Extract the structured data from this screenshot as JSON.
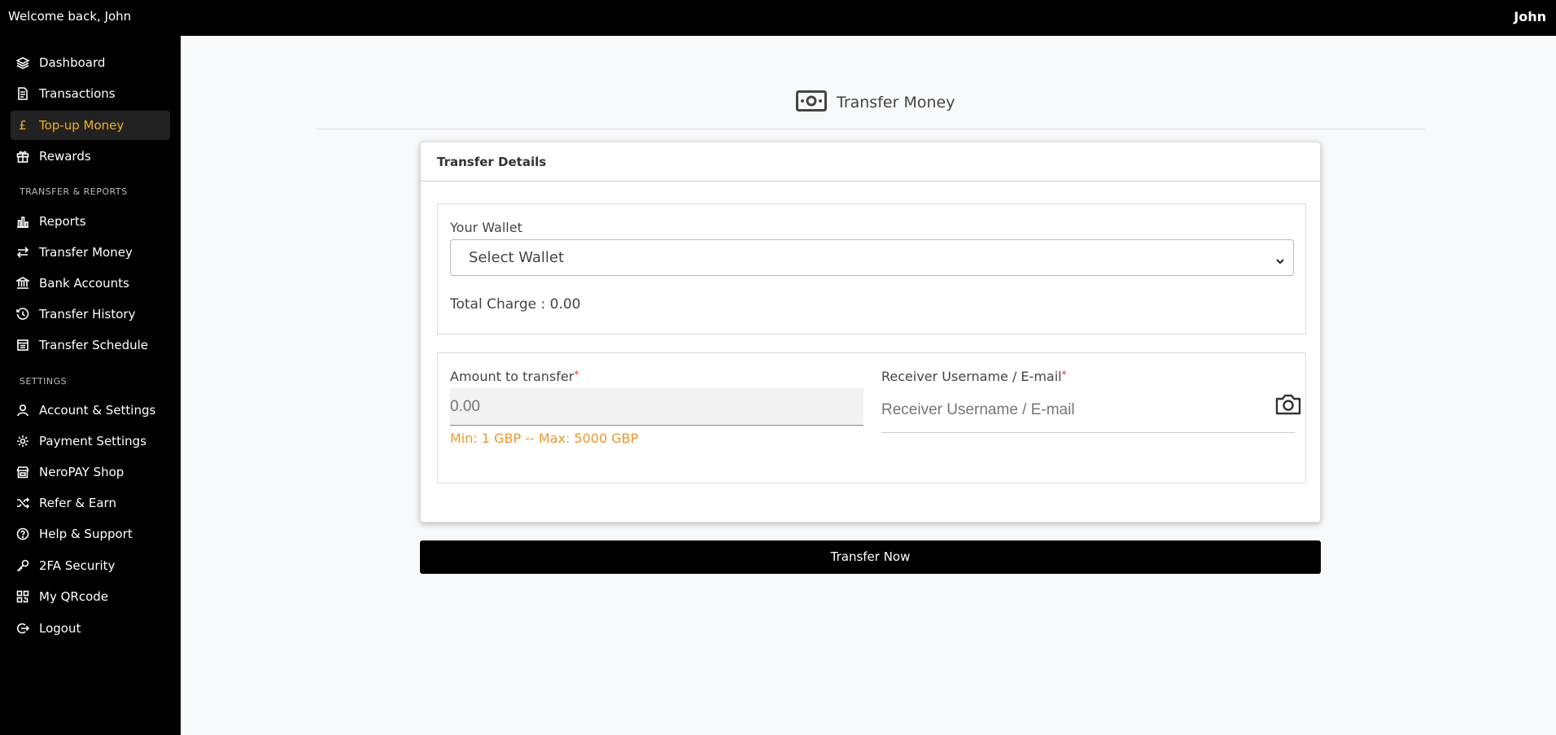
{
  "topbar": {
    "welcome": "Welcome back, John",
    "username": "John"
  },
  "sidebar": {
    "items": [
      {
        "label": "Dashboard",
        "icon": "layers-icon"
      },
      {
        "label": "Transactions",
        "icon": "document-icon"
      },
      {
        "label": "Top-up Money",
        "icon": "pound-icon",
        "active": true
      },
      {
        "label": "Rewards",
        "icon": "gift-icon"
      },
      {
        "label": "Reports",
        "icon": "bar-chart-icon"
      },
      {
        "label": "Transfer Money",
        "icon": "transfer-arrows-icon"
      },
      {
        "label": "Bank Accounts",
        "icon": "bank-icon"
      },
      {
        "label": "Transfer History",
        "icon": "history-icon"
      },
      {
        "label": "Transfer Schedule",
        "icon": "schedule-icon"
      },
      {
        "label": "Account & Settings",
        "icon": "user-icon"
      },
      {
        "label": "Payment Settings",
        "icon": "gear-icon"
      },
      {
        "label": "NeroPAY Shop",
        "icon": "shop-icon"
      },
      {
        "label": "Refer & Earn",
        "icon": "shuffle-icon"
      },
      {
        "label": "Help & Support",
        "icon": "help-icon"
      },
      {
        "label": "2FA Security",
        "icon": "key-icon"
      },
      {
        "label": "My QRcode",
        "icon": "qrcode-icon"
      },
      {
        "label": "Logout",
        "icon": "logout-icon"
      }
    ],
    "sections": {
      "transfer_reports": "TRANSFER & REPORTS",
      "settings": "SETTINGS"
    }
  },
  "page": {
    "title": "Transfer Money",
    "icon": "money-bill-icon"
  },
  "card": {
    "title": "Transfer Details",
    "wallet_label": "Your Wallet",
    "wallet_selected": "Select Wallet",
    "total_charge": "Total Charge : 0.00",
    "amount_label": "Amount to transfer",
    "amount_placeholder": "0.00",
    "amount_hint": "Min: 1 GBP -- Max: 5000 GBP",
    "receiver_label": "Receiver Username / E-mail",
    "receiver_placeholder": "Receiver Username / E-mail",
    "required_mark": "*"
  },
  "actions": {
    "transfer_now": "Transfer Now"
  },
  "colors": {
    "accent": "#f2b01e",
    "hint": "#f0962b",
    "required": "#e3342f",
    "sidebar_bg": "#000000"
  }
}
